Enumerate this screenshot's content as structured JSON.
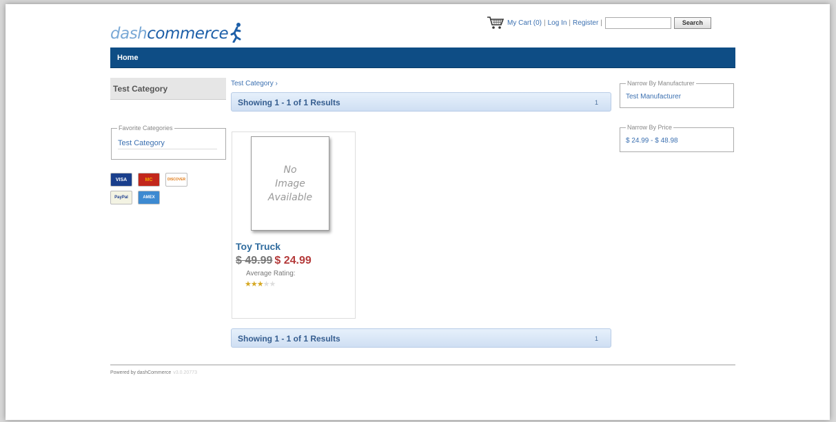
{
  "header": {
    "logo": {
      "part1": "dash",
      "part2": "commerce"
    },
    "links": {
      "cart": "My Cart (0)",
      "login": "Log In",
      "register": "Register",
      "sep": "|"
    },
    "search": {
      "value": "",
      "button": "Search"
    }
  },
  "nav": {
    "home": "Home"
  },
  "sidebar": {
    "category_header": "Test Category",
    "favorites": {
      "legend": "Favorite Categories",
      "items": [
        "Test Category"
      ]
    },
    "cards": [
      "VISA",
      "MC",
      "DISCOVER",
      "PayPal",
      "AMEX"
    ]
  },
  "main": {
    "breadcrumb": "Test Category ›",
    "results_text": "Showing 1 - 1 of 1 Results",
    "pager": "1",
    "product": {
      "image_text": [
        "No",
        "Image",
        "Available"
      ],
      "name": "Toy Truck",
      "old_price": "$ 49.99",
      "new_price": "$ 24.99",
      "rating_label": "Average Rating:",
      "rating": 3,
      "rating_max": 5
    }
  },
  "filters": {
    "manufacturer": {
      "legend": "Narrow By Manufacturer",
      "item": "Test Manufacturer"
    },
    "price": {
      "legend": "Narrow By Price",
      "item": "$ 24.99 - $ 48.98"
    }
  },
  "footer": {
    "powered": "Powered by dashCommerce",
    "version": "v3.0.20773"
  },
  "colors": {
    "nav_bg": "#0e4d85",
    "link": "#3a6fb0",
    "sale_price": "#b43a3a",
    "results_bar": "#cfdff3"
  }
}
